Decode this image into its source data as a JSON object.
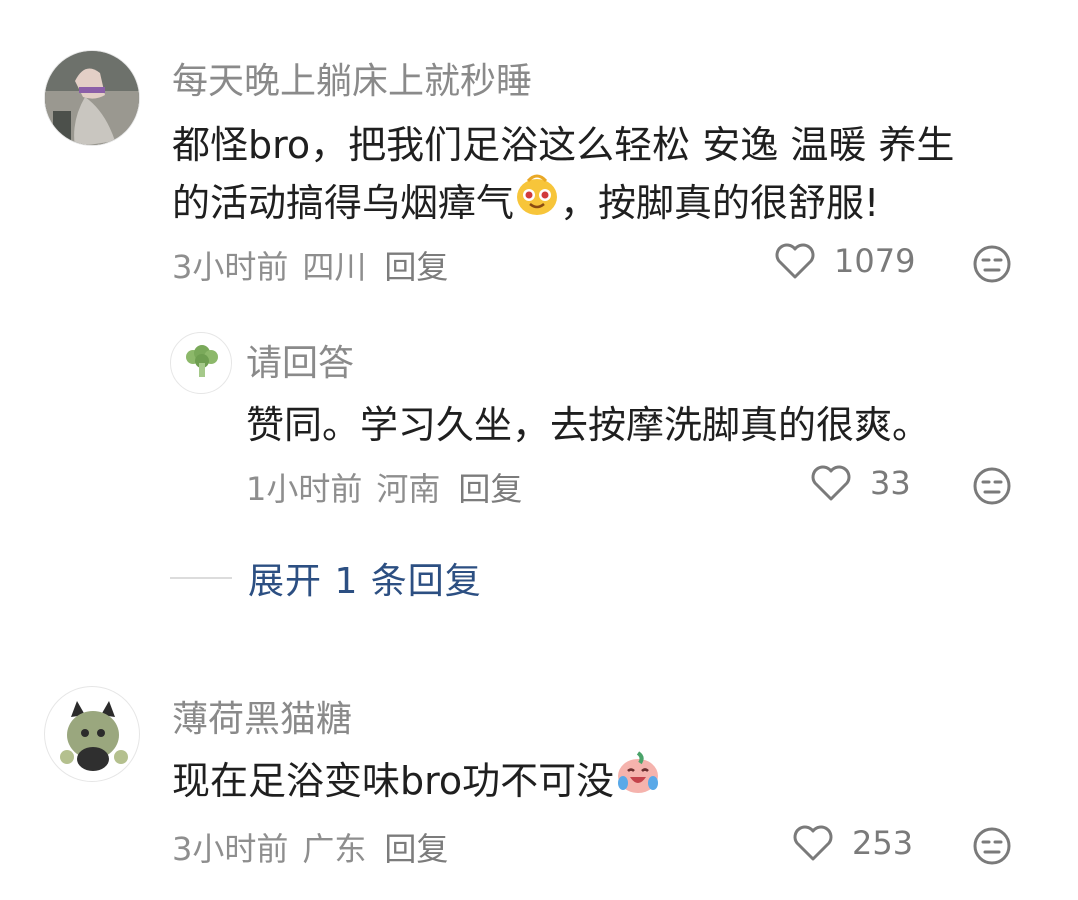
{
  "comments": [
    {
      "username": "每天晚上躺床上就秒睡",
      "content_line1": "都怪bro，把我们足浴这么轻松 安逸 温暖 养生",
      "content_line2_pre": "的活动搞得乌烟瘴气",
      "content_line2_post": "，按脚真的很舒服!",
      "time": "3小时前",
      "location": "四川",
      "reply_label": "回复",
      "likes": "1079",
      "emoji": "smug-face-emoji"
    },
    {
      "username": "请回答",
      "content": "赞同。学习久坐，去按摩洗脚真的很爽。",
      "time": "1小时前",
      "location": "河南",
      "reply_label": "回复",
      "likes": "33"
    },
    {
      "username": "薄荷黑猫糖",
      "content_pre": "现在足浴变味bro功不可没",
      "time": "3小时前",
      "location": "广东",
      "reply_label": "回复",
      "likes": "253",
      "emoji": "laugh-cry-emoji"
    }
  ],
  "expand_replies": "展开 1 条回复",
  "colors": {
    "username": "#8a8a8a",
    "content": "#1f1f1f",
    "meta": "#8e8e8e",
    "expand": "#2c4f82"
  }
}
